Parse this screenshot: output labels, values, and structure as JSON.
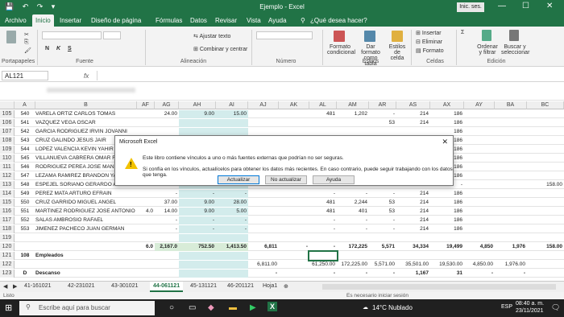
{
  "title": {
    "quick_access": "💾 ↶ ↷ ▾",
    "doc": "Ejemplo - Excel",
    "signin": "Inic. ses.",
    "min": "—",
    "max": "☐",
    "close": "✕"
  },
  "tabs": [
    "Archivo",
    "Inicio",
    "Insertar",
    "Diseño de página",
    "Fórmulas",
    "Datos",
    "Revisar",
    "Vista",
    "Ayuda",
    "¿Qué desea hacer?"
  ],
  "ribbon": {
    "groups": [
      "Portapapeles",
      "Fuente",
      "Alineación",
      "Número",
      "Estilos",
      "Celdas",
      "Edición"
    ],
    "font_buttons": [
      "N",
      "K",
      "S"
    ],
    "wrap": "Ajustar texto",
    "merge": "Combinar y centrar",
    "cond_format": "Formato condicional",
    "table_format": "Dar formato como tabla",
    "cell_styles": "Estilos de celda",
    "insert": "Insertar",
    "delete": "Eliminar",
    "format": "Formato",
    "sort": "Ordenar y filtrar",
    "find": "Buscar y seleccionar"
  },
  "formula_bar": {
    "namebox": "AL121",
    "fx": "fx"
  },
  "columns": [
    "A",
    "B",
    "AF",
    "AG",
    "AH",
    "AI",
    "AJ",
    "AK",
    "AL",
    "AM",
    "AR",
    "AS",
    "AX",
    "AY",
    "BA",
    "BC"
  ],
  "rows": [
    {
      "n": "105",
      "a": "540",
      "b": "VARELA ORTIZ CARLOS TOMAS",
      "ag": "24.00",
      "ah": "9.00",
      "ai": "15.00",
      "al": "481",
      "am": "1,202",
      "ar": "-",
      "as": "214",
      "ax": "186"
    },
    {
      "n": "106",
      "a": "541",
      "b": "VAZQUEZ VEGA OSCAR",
      "ar": "53",
      "as": "214",
      "ax": "186"
    },
    {
      "n": "107",
      "a": "542",
      "b": "GARCIA RODRIGUEZ IRVIN JOVANNI",
      "ax": "186"
    },
    {
      "n": "108",
      "a": "543",
      "b": "CRUZ GALINDO JESUS JAIR",
      "ax": "186"
    },
    {
      "n": "109",
      "a": "544",
      "b": "LOPEZ VALENCIA KEVIN YAHIR",
      "ax": "186"
    },
    {
      "n": "110",
      "a": "545",
      "b": "VILLANUEVA CABRERA OMAR ROBERT",
      "ax": "186"
    },
    {
      "n": "111",
      "a": "546",
      "b": "RODRIGUEZ PEREA JOSE MANUEL",
      "ax": "186"
    },
    {
      "n": "112",
      "a": "547",
      "b": "LEZAMA RAMIREZ BRANDON YAIR",
      "ax": "186"
    },
    {
      "n": "113",
      "a": "548",
      "b": "ESPEJEL SORIANO GERARDO AZAEL",
      "ag": "-",
      "ah": "-",
      "ai": "-",
      "al": "-",
      "am": "-",
      "ar": "-",
      "as": "155",
      "ax": "-",
      "bc": "158.00"
    },
    {
      "n": "114",
      "a": "549",
      "b": "PEREZ MATA ARTURO EFRAIN",
      "ag": "-",
      "ah": "-",
      "ai": "-",
      "al": "-",
      "am": "-",
      "ar": "-",
      "as": "214",
      "ax": "186"
    },
    {
      "n": "115",
      "a": "550",
      "b": "CRUZ GARRIDO MIGUEL ANGEL",
      "ag": "37.00",
      "ah": "9.00",
      "ai": "28.00",
      "al": "481",
      "am": "2,244",
      "ar": "53",
      "as": "214",
      "ax": "186"
    },
    {
      "n": "116",
      "a": "551",
      "b": "MARTINEZ RODRIGUEZ JOSE ANTONIO",
      "af": "4.0",
      "ag": "14.00",
      "ah": "9.00",
      "ai": "5.00",
      "al": "481",
      "am": "401",
      "ar": "53",
      "as": "214",
      "ax": "186"
    },
    {
      "n": "117",
      "a": "552",
      "b": "SALAS AMBROSIO RAFAEL",
      "ag": "-",
      "ah": "-",
      "ai": "-",
      "al": "-",
      "am": "-",
      "ar": "-",
      "as": "214",
      "ax": "186"
    },
    {
      "n": "118",
      "a": "553",
      "b": "JIMENEZ PACHECO JUAN GERMAN",
      "ag": "-",
      "ah": "-",
      "ai": "-",
      "al": "-",
      "am": "-",
      "ar": "-",
      "as": "214",
      "ax": "186"
    },
    {
      "n": "119",
      "a": "",
      "b": ""
    },
    {
      "n": "120",
      "a": "",
      "b": "",
      "af": "6.0",
      "ag": "2,167.0",
      "ah": "752.50",
      "ai": "1,413.50",
      "aj": "6,811",
      "ak": "-",
      "al": "-",
      "am": "172,225",
      "ar": "5,571",
      "as": "34,334",
      "ax": "19,499",
      "ay": "4,850",
      "ba": "1,976",
      "bc": "158.00"
    },
    {
      "n": "121",
      "a": "108",
      "b": "Empleados"
    },
    {
      "n": "122",
      "a": "",
      "b": "",
      "aj": "6,811.00",
      "al": "61,250.00",
      "am": "172,225.00",
      "ar": "5,571.00",
      "as": "35,501.00",
      "ax": "19,530.00",
      "ay": "4,850.00",
      "ba": "1,976.00"
    },
    {
      "n": "123",
      "a": "D",
      "b": "Descanso",
      "aj": "-",
      "al": "-",
      "am": "-",
      "ar": "-",
      "as": "1,167",
      "ax": "31",
      "ay": "-",
      "ba": "-"
    }
  ],
  "sheet_tabs": [
    "41-161021",
    "42-231021",
    "43-301021",
    "44-061121",
    "45-131121",
    "46-201121",
    "Hoja1"
  ],
  "active_sheet": "44-061121",
  "status": {
    "left": "Listo",
    "middle": "Es necesario iniciar sesión"
  },
  "dialog": {
    "title": "Microsoft Excel",
    "msg1": "Este libro contiene vínculos a uno o más fuentes externas que podrían no ser seguras.",
    "msg2": "Si confía en los vínculos, actualícelos para obtener los datos más recientes. En caso contrario, puede seguir trabajando con los datos que tenga.",
    "btn_update": "Actualizar",
    "btn_noupdate": "No actualizar",
    "btn_help": "Ayuda",
    "close": "✕"
  },
  "taskbar": {
    "search": "Escribe aquí para buscar",
    "weather": "14°C Nublado",
    "lang": "ESP",
    "time": "08:40 a. m.",
    "date": "23/11/2021"
  },
  "colors": {
    "excel_green": "#217346",
    "highlight_green": "#d8ecd8",
    "highlight_teal": "#d3ecec"
  }
}
